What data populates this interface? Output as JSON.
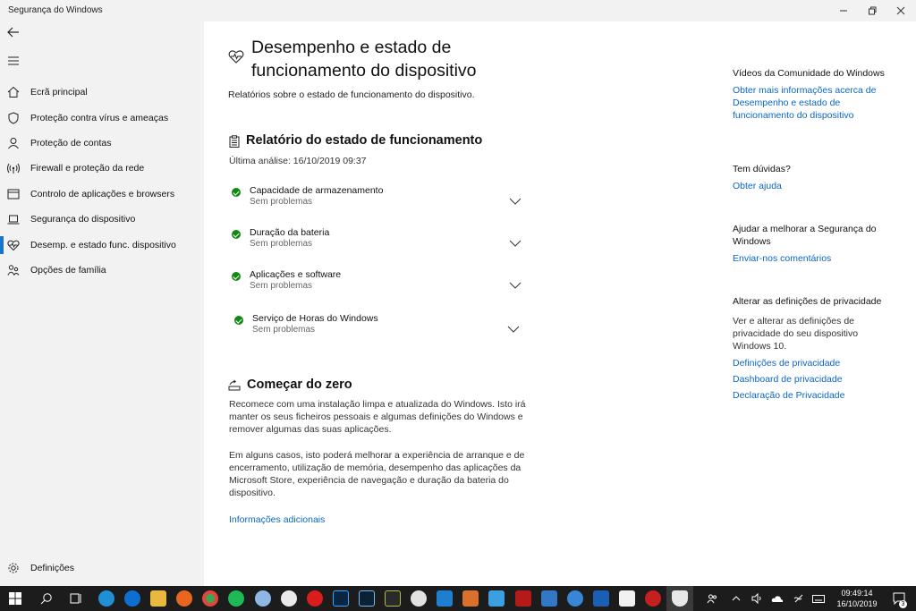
{
  "window": {
    "title": "Segurança do Windows"
  },
  "sidebar": {
    "items": [
      {
        "label": "Ecrã principal",
        "icon": "home-icon"
      },
      {
        "label": "Proteção contra vírus e ameaças",
        "icon": "shield-icon"
      },
      {
        "label": "Proteção de contas",
        "icon": "person-icon"
      },
      {
        "label": "Firewall e proteção da rede",
        "icon": "wifi-antenna-icon"
      },
      {
        "label": "Controlo de aplicações e browsers",
        "icon": "app-window-icon"
      },
      {
        "label": "Segurança do dispositivo",
        "icon": "laptop-icon"
      },
      {
        "label": "Desemp. e estado func. dispositivo",
        "icon": "heart-pulse-icon",
        "active": true
      },
      {
        "label": "Opções de família",
        "icon": "family-icon"
      }
    ],
    "settings_label": "Definições"
  },
  "main": {
    "title": "Desempenho e estado de funcionamento do dispositivo",
    "subtitle": "Relatórios sobre o estado de funcionamento do dispositivo.",
    "report": {
      "title": "Relatório do estado de funcionamento",
      "last_scan": "Última análise:  16/10/2019 09:37",
      "items": [
        {
          "title": "Capacidade de armazenamento",
          "status": "Sem problemas"
        },
        {
          "title": "Duração da bateria",
          "status": "Sem problemas"
        },
        {
          "title": "Aplicações e software",
          "status": "Sem problemas"
        },
        {
          "title": "Serviço de Horas do Windows",
          "status": "Sem problemas"
        }
      ]
    },
    "fresh_start": {
      "title": "Começar do zero",
      "para1": "Recomece com uma instalação limpa e atualizada do Windows. Isto irá manter os seus ficheiros pessoais e algumas definições do Windows e remover algumas das suas aplicações.",
      "para2": "Em alguns casos, isto poderá melhorar a experiência de arranque e de encerramento, utilização de memória, desempenho das aplicações da Microsoft Store, experiência de navegação e duração da bateria do dispositivo.",
      "link": "Informações adicionais"
    }
  },
  "right": {
    "community": {
      "heading": "Vídeos da Comunidade do Windows",
      "link": "Obter mais informações acerca de Desempenho e estado de funcionamento do dispositivo"
    },
    "questions": {
      "heading": "Tem dúvidas?",
      "link": "Obter ajuda"
    },
    "improve": {
      "heading": "Ajudar a melhorar a Segurança do Windows",
      "link": "Enviar-nos comentários"
    },
    "privacy": {
      "heading": "Alterar as definições de privacidade",
      "text": "Ver e alterar as definições de privacidade do seu dispositivo Windows 10.",
      "links": [
        "Definições de privacidade",
        "Dashboard de privacidade",
        "Declaração de Privacidade"
      ]
    }
  },
  "taskbar": {
    "time": "09:49:14",
    "date": "16/10/2019",
    "notifications": "3",
    "colors": {
      "background": "#1c1c1c",
      "accent": "#0b66c2",
      "ok": "#118a11"
    }
  }
}
